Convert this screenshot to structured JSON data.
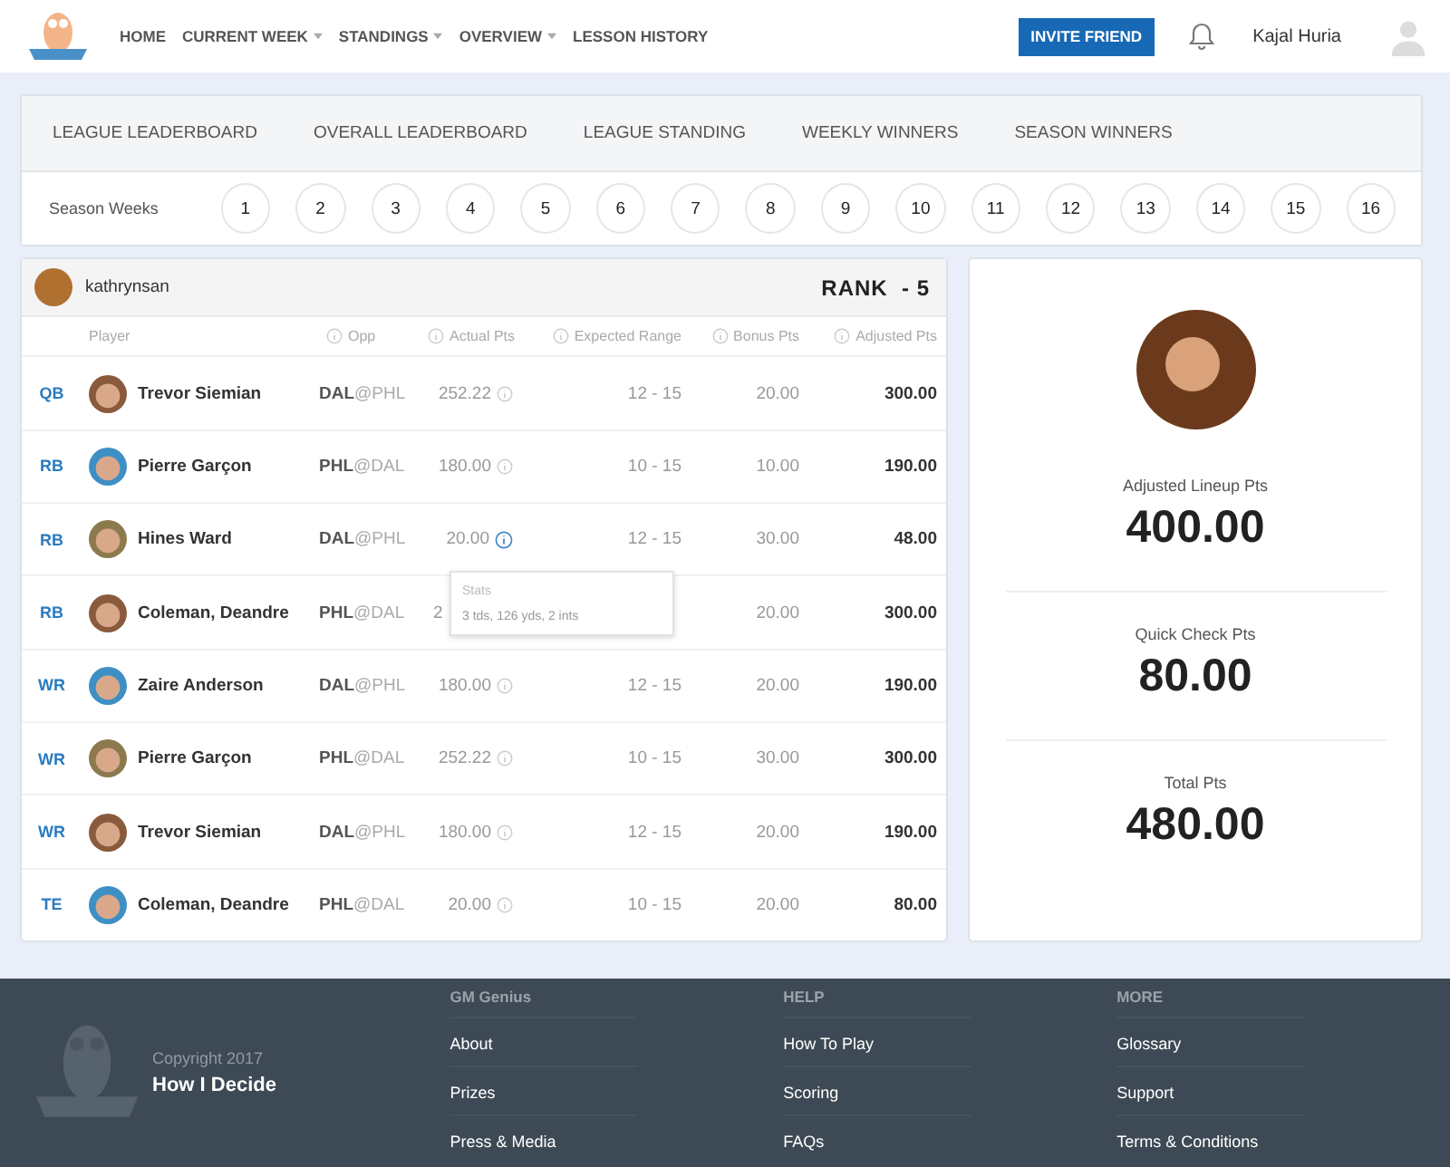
{
  "nav": {
    "items": [
      {
        "label": "HOME",
        "dropdown": false
      },
      {
        "label": "CURRENT WEEK",
        "dropdown": true
      },
      {
        "label": "STANDINGS",
        "dropdown": true
      },
      {
        "label": "OVERVIEW",
        "dropdown": true
      },
      {
        "label": "LESSON HISTORY",
        "dropdown": false
      }
    ],
    "invite_button": "INVITE FRIEND",
    "user_name": "Kajal Huria"
  },
  "tabs": [
    {
      "label": "LEAGUE LEADERBOARD",
      "selected": false
    },
    {
      "label": "OVERALL LEADERBOARD",
      "selected": false
    },
    {
      "label": "LEAGUE STANDING",
      "selected": false
    },
    {
      "label": "WEEKLY WINNERS",
      "selected": false
    },
    {
      "label": "SEASON WINNERS",
      "selected": false
    }
  ],
  "season_weeks": {
    "label": "Season Weeks",
    "weeks": [
      {
        "label": "1",
        "selected": false
      },
      {
        "label": "2",
        "selected": false
      },
      {
        "label": "3",
        "selected": false
      },
      {
        "label": "4",
        "selected": false
      },
      {
        "label": "5",
        "selected": false
      },
      {
        "label": "6",
        "selected": false
      },
      {
        "label": "7",
        "selected": false
      },
      {
        "label": "8",
        "selected": false
      },
      {
        "label": "9",
        "selected": false
      },
      {
        "label": "10",
        "selected": false
      },
      {
        "label": "11",
        "selected": false
      },
      {
        "label": "12",
        "selected": false
      },
      {
        "label": "13",
        "selected": false
      },
      {
        "label": "14",
        "selected": false
      },
      {
        "label": "15",
        "selected": false
      },
      {
        "label": "16",
        "selected": false
      }
    ]
  },
  "lineup": {
    "user": "kathrynsan",
    "rank": "RANK  - 5",
    "columns": [
      {
        "label": "Player",
        "info": false
      },
      {
        "label": "Opp",
        "info": true
      },
      {
        "label": "Actual Pts",
        "info": true
      },
      {
        "label": "Expected Range",
        "info": true
      },
      {
        "label": "Bonus Pts",
        "info": true
      },
      {
        "label": "Adjusted Pts",
        "info": true
      }
    ],
    "rows": [
      {
        "pos": "QB",
        "player": "Trevor Siemian",
        "opp_team": "DAL",
        "opp_rest": "@PHL",
        "actual_pts": "252.22",
        "info_active": false,
        "expected_range": "12 - 15",
        "bonus_pts": "20.00",
        "adjusted_pts": "300.00"
      },
      {
        "pos": "RB",
        "player": "Pierre Garçon",
        "opp_team": "PHL",
        "opp_rest": "@DAL",
        "actual_pts": "180.00",
        "info_active": false,
        "expected_range": "10 - 15",
        "bonus_pts": "10.00",
        "adjusted_pts": "190.00"
      },
      {
        "pos": "RB",
        "player": "Hines Ward",
        "opp_team": "DAL",
        "opp_rest": "@PHL",
        "actual_pts": "20.00",
        "info_active": true,
        "expected_range": "12 - 15",
        "bonus_pts": "30.00",
        "adjusted_pts": "48.00"
      },
      {
        "pos": "RB",
        "player": "Coleman, Deandre",
        "opp_team": "PHL",
        "opp_rest": "@DAL",
        "actual_pts": "2",
        "info_active": false,
        "bonus_pts": "20.00",
        "adjusted_pts": "300.00",
        "covered": true
      },
      {
        "pos": "WR",
        "player": "Zaire Anderson",
        "opp_team": "DAL",
        "opp_rest": "@PHL",
        "actual_pts": "180.00",
        "info_active": false,
        "expected_range": "12 - 15",
        "bonus_pts": "20.00",
        "adjusted_pts": "190.00"
      },
      {
        "pos": "WR",
        "player": "Pierre Garçon",
        "opp_team": "PHL",
        "opp_rest": "@DAL",
        "actual_pts": "252.22",
        "info_active": false,
        "expected_range": "10 - 15",
        "bonus_pts": "30.00",
        "adjusted_pts": "300.00"
      },
      {
        "pos": "WR",
        "player": "Trevor Siemian",
        "opp_team": "DAL",
        "opp_rest": "@PHL",
        "actual_pts": "180.00",
        "info_active": false,
        "expected_range": "12 - 15",
        "bonus_pts": "20.00",
        "adjusted_pts": "190.00"
      },
      {
        "pos": "TE",
        "player": "Coleman, Deandre",
        "opp_team": "PHL",
        "opp_rest": "@DAL",
        "actual_pts": "20.00",
        "info_active": false,
        "expected_range": "10 - 15",
        "bonus_pts": "20.00",
        "adjusted_pts": "80.00"
      }
    ],
    "tooltip": {
      "title": "Stats",
      "text": "3 tds, 126 yds, 2 ints"
    }
  },
  "summary": [
    {
      "label": "Adjusted Lineup Pts",
      "value": "400.00"
    },
    {
      "label": "Quick Check Pts",
      "value": "80.00"
    },
    {
      "label": "Total Pts",
      "value": "480.00"
    }
  ],
  "footer": {
    "copyright": "Copyright 2017",
    "brand": "How I Decide",
    "columns": [
      {
        "heading": "GM Genius",
        "links": [
          "About",
          "Prizes",
          "Press & Media"
        ]
      },
      {
        "heading": "HELP",
        "links": [
          "How To Play",
          "Scoring",
          "FAQs"
        ]
      },
      {
        "heading": "MORE",
        "links": [
          "Glossary",
          "Support",
          "Terms & Conditions"
        ]
      }
    ]
  }
}
